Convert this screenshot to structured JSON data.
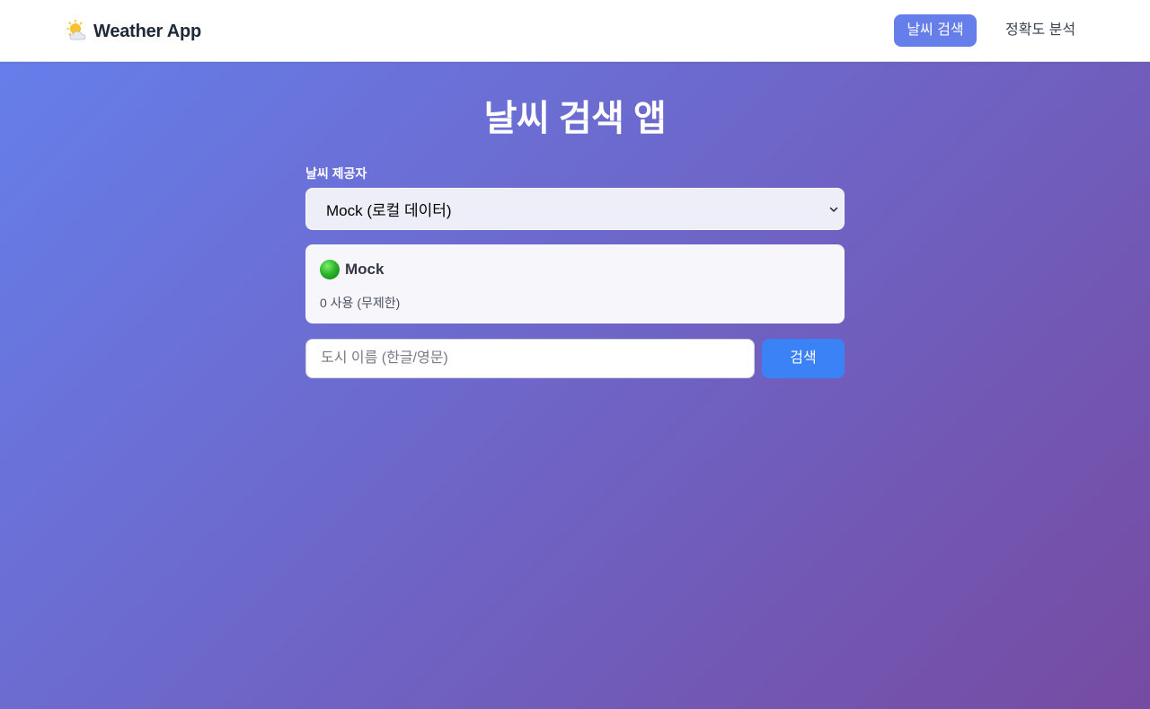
{
  "navbar": {
    "brand_icon": "sun-behind-cloud-icon",
    "brand_title": "Weather App",
    "links": [
      {
        "label": "날씨 검색",
        "active": true
      },
      {
        "label": "정확도 분석",
        "active": false
      }
    ]
  },
  "main": {
    "title": "날씨 검색 앱",
    "provider": {
      "label": "날씨 제공자",
      "selected": "Mock (로컬 데이터)"
    },
    "status": {
      "icon": "green-circle-icon",
      "name": "Mock",
      "usage": "0 사용 (무제한)"
    },
    "search": {
      "placeholder": "도시 이름 (한글/영문)",
      "value": "",
      "button_label": "검색"
    }
  },
  "colors": {
    "gradient_start": "#667eea",
    "gradient_end": "#764ba2",
    "active_nav": "#667eea",
    "search_button": "#3b82f6",
    "status_dot": "#2fb52a"
  }
}
